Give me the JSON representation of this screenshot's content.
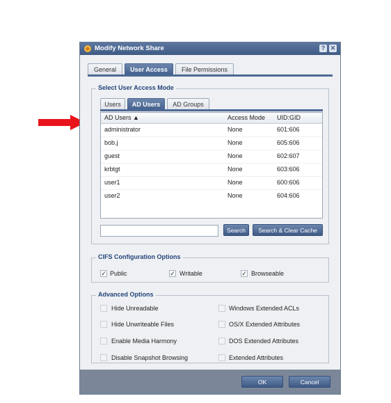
{
  "dialog": {
    "title": "Modify Network Share",
    "help_label": "?",
    "close_label": "✕"
  },
  "main_tabs": [
    {
      "label": "General",
      "active": false
    },
    {
      "label": "User Access",
      "active": true
    },
    {
      "label": "File Permissions",
      "active": false
    }
  ],
  "user_access": {
    "legend": "Select User Access Mode",
    "tabs": [
      {
        "label": "Users",
        "active": false
      },
      {
        "label": "AD Users",
        "active": true
      },
      {
        "label": "AD Groups",
        "active": false
      }
    ],
    "columns": [
      "AD Users ▲",
      "Access Mode",
      "UID:GID"
    ],
    "rows": [
      {
        "name": "administrator",
        "mode": "None",
        "uid": "601:606"
      },
      {
        "name": "bob.j",
        "mode": "None",
        "uid": "605:606"
      },
      {
        "name": "guest",
        "mode": "None",
        "uid": "602:607"
      },
      {
        "name": "krbtgt",
        "mode": "None",
        "uid": "603:606"
      },
      {
        "name": "user1",
        "mode": "None",
        "uid": "600:606"
      },
      {
        "name": "user2",
        "mode": "None",
        "uid": "604:606"
      }
    ],
    "search_value": "",
    "search_label": "Search",
    "search_clear_label": "Search & Clear Cache"
  },
  "cifs": {
    "legend": "CIFS Configuration Options",
    "options": [
      {
        "label": "Public",
        "checked": true
      },
      {
        "label": "Writable",
        "checked": true
      },
      {
        "label": "Browseable",
        "checked": true
      }
    ]
  },
  "advanced": {
    "legend": "Advanced Options",
    "options": [
      {
        "label": "Hide Unreadable",
        "checked": false
      },
      {
        "label": "Windows Extended ACLs",
        "checked": false
      },
      {
        "label": "Hide Unwriteable Files",
        "checked": false
      },
      {
        "label": "OS/X Extended Attributes",
        "checked": false
      },
      {
        "label": "Enable Media Harmony",
        "checked": false
      },
      {
        "label": "DOS Extended Attributes",
        "checked": false
      },
      {
        "label": "Disable Snapshot Browsing",
        "checked": false
      },
      {
        "label": "Extended Attributes",
        "checked": false
      }
    ]
  },
  "footer": {
    "ok_label": "OK",
    "cancel_label": "Cancel"
  },
  "colors": {
    "arrow": "#e8131b",
    "accent": "#45628f"
  }
}
